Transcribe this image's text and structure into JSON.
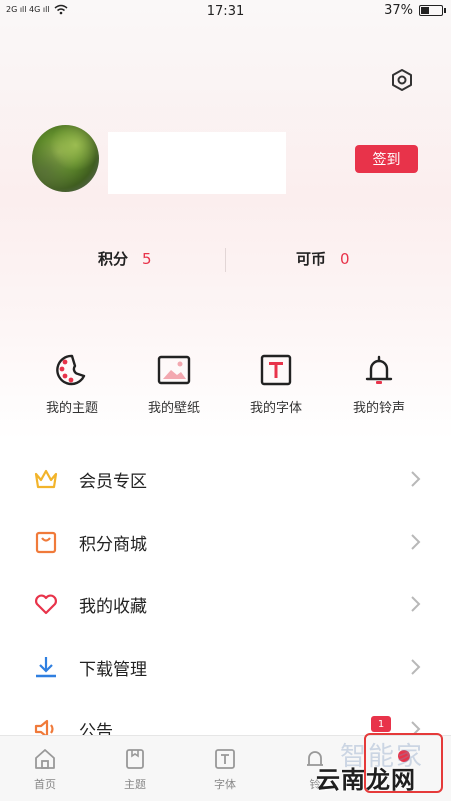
{
  "status_bar": {
    "signal_left": "2G ıll 4G ıll",
    "time": "17:31",
    "battery": "37%",
    "battery_level": 0.37
  },
  "profile": {
    "signin_label": "签到"
  },
  "stats": {
    "points_label": "积分",
    "points_value": "5",
    "coins_label": "可币",
    "coins_value": "0"
  },
  "quick_links": [
    {
      "label": "我的主题",
      "icon": "theme-palette-icon"
    },
    {
      "label": "我的壁纸",
      "icon": "wallpaper-image-icon"
    },
    {
      "label": "我的字体",
      "icon": "font-t-icon"
    },
    {
      "label": "我的铃声",
      "icon": "bell-icon"
    }
  ],
  "menu": [
    {
      "label": "会员专区",
      "icon": "crown-icon",
      "color": "#f2b42b"
    },
    {
      "label": "积分商城",
      "icon": "shopping-bag-icon",
      "color": "#f07a3a"
    },
    {
      "label": "我的收藏",
      "icon": "heart-icon",
      "color": "#e8334a"
    },
    {
      "label": "下载管理",
      "icon": "download-icon",
      "color": "#2f7fe0"
    },
    {
      "label": "公告",
      "icon": "speaker-icon",
      "color": "#f07a3a",
      "badge": "1"
    }
  ],
  "tabs": [
    {
      "label": "首页",
      "icon": "home-icon"
    },
    {
      "label": "主题",
      "icon": "theme-icon"
    },
    {
      "label": "字体",
      "icon": "font-icon"
    },
    {
      "label": "铃",
      "icon": "bell-icon"
    },
    {
      "label": "",
      "icon": "me-icon"
    }
  ],
  "watermark": {
    "top": "智能家",
    "main": "云南龙网"
  },
  "colors": {
    "accent": "#e8334a",
    "highlight": "#e53a3a"
  }
}
